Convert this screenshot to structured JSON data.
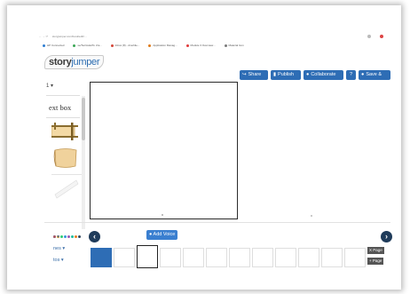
{
  "browser": {
    "url": "storyjumper.com/book/edit/…",
    "bookmarks": [
      {
        "label": "HP Connected",
        "color": "#2e7dd1"
      },
      {
        "label": "se/Tec/Aula/To r/ra...",
        "color": "#3aa655"
      },
      {
        "label": "Inbox (8) - dmohile...",
        "color": "#d44638"
      },
      {
        "label": "Application Manag...",
        "color": "#e07b17"
      },
      {
        "label": "Module 3 Overview...",
        "color": "#e03a3a"
      },
      {
        "label": "Material Icon",
        "color": "#7a7a7a"
      }
    ]
  },
  "app": {
    "logo_story": "story",
    "logo_jumper": "jumper"
  },
  "toolbar": {
    "share": "Share",
    "publish": "Publish",
    "collaborate": "Collaborate",
    "help": "?",
    "save": "Save &"
  },
  "left_panel": {
    "top_label": "1 ▾",
    "textbox_label": "ext box",
    "dropdowns": [
      "s ▾",
      "nes ▾",
      "tos ▾"
    ],
    "palette_colors": [
      "#e84c3d",
      "#f39c12",
      "#2ecc71",
      "#3498db",
      "#9b59b6",
      "#1abc9c",
      "#e67e22",
      "#34495e"
    ]
  },
  "editor": {
    "add_voice": "Add Voice",
    "prev_icon": "chevron-left-icon",
    "next_icon": "chevron-right-icon"
  },
  "thumbnails": {
    "count": 12,
    "selected_index": 2,
    "filled_index": 0,
    "side_buttons": [
      "X Page",
      "+ Page"
    ]
  },
  "colors": {
    "accent": "#2e6db5",
    "nav_dark": "#1f3b5a"
  }
}
